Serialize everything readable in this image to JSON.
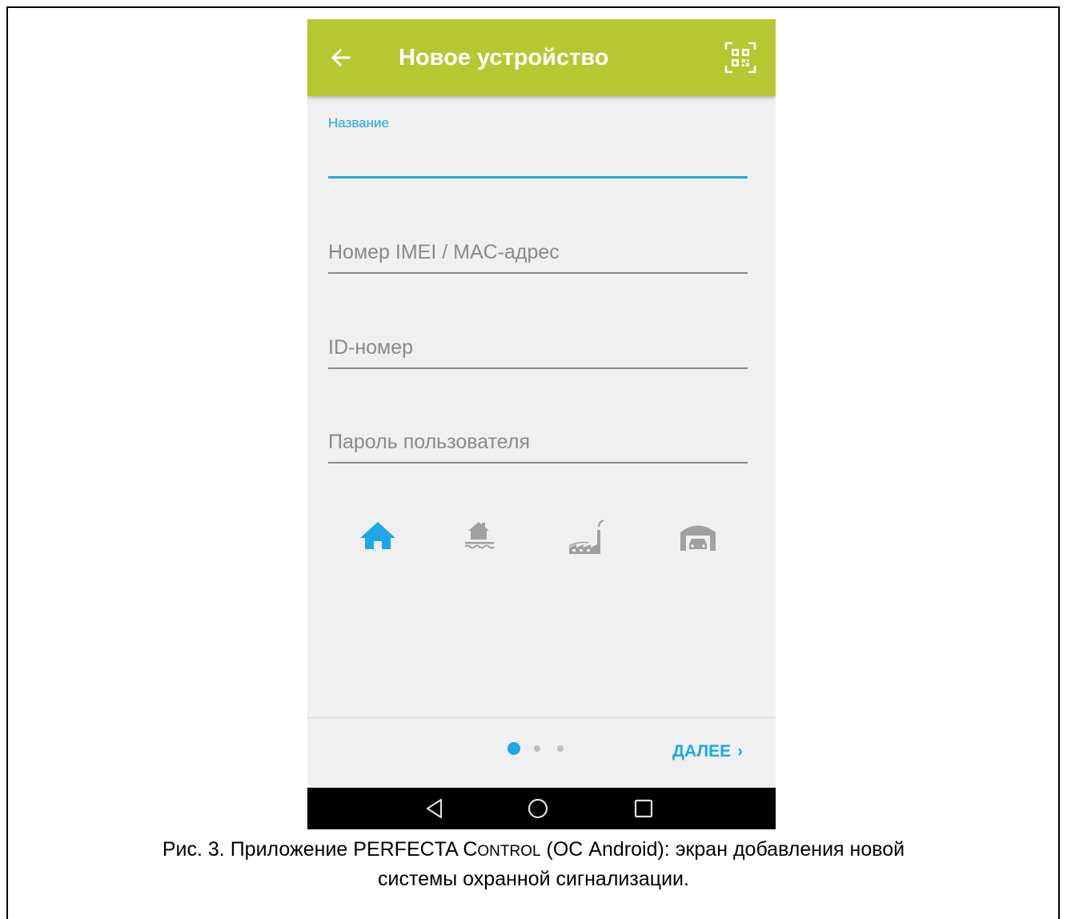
{
  "appbar": {
    "title": "Новое устройство",
    "color": "#b6c831",
    "back_icon": "arrow-left-icon",
    "qr_icon": "qr-code-scan-icon"
  },
  "form": {
    "name_label": "Название",
    "name_value": "",
    "imei_placeholder": "Номер IMEI / MAC-адрес",
    "id_placeholder": "ID-номер",
    "password_placeholder": "Пароль пользователя"
  },
  "object_types": [
    {
      "icon": "house-icon",
      "selected": true
    },
    {
      "icon": "house-on-water-icon",
      "selected": false
    },
    {
      "icon": "factory-icon",
      "selected": false
    },
    {
      "icon": "garage-car-icon",
      "selected": false
    }
  ],
  "pager": {
    "count": 3,
    "active": 0
  },
  "next_button": {
    "label": "ДАЛЕЕ",
    "icon": "chevron-right-icon"
  },
  "navbar": {
    "icons": [
      "nav-back-icon",
      "nav-home-icon",
      "nav-recents-icon"
    ]
  },
  "accent_color": "#1ea7e8",
  "caption": {
    "line1_prefix": "Рис. 3. Приложение PERFECTA C",
    "line1_smallcaps": "ONTROL",
    "line1_suffix": " (ОС Android): экран добавления новой",
    "line2": "системы охранной сигнализации."
  }
}
